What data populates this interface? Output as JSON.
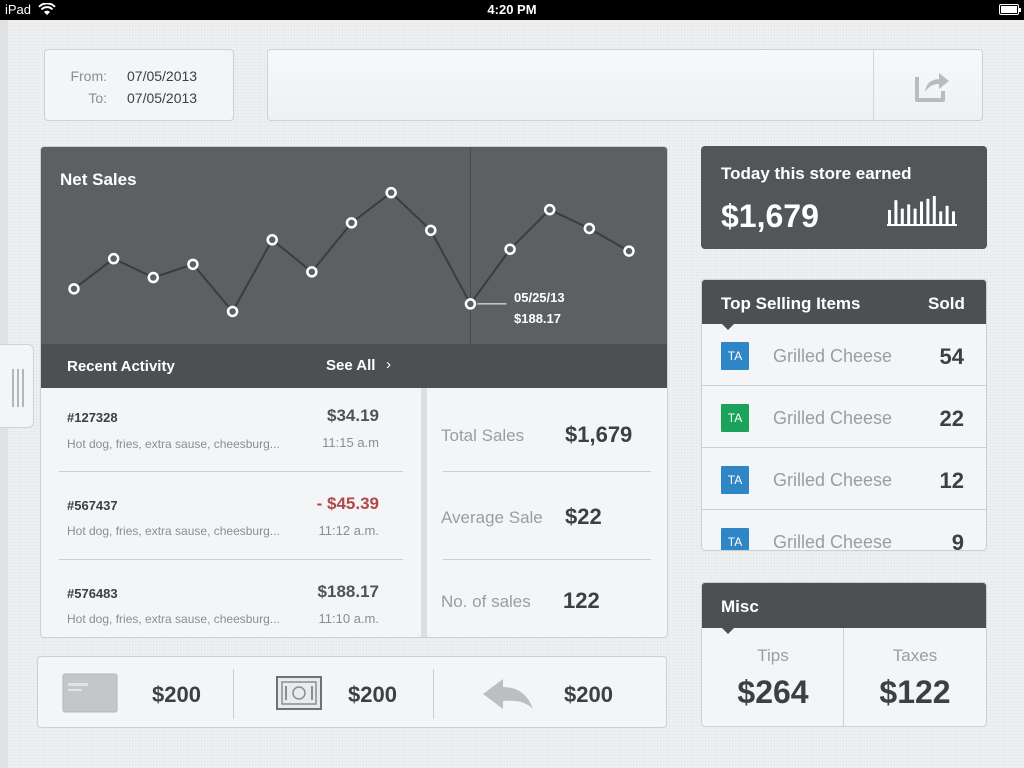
{
  "status_bar": {
    "device": "iPad",
    "time": "4:20 PM"
  },
  "date_range": {
    "from_label": "From:",
    "from_value": "07/05/2013",
    "to_label": "To:",
    "to_value": "07/05/2013"
  },
  "search": {
    "value": "",
    "placeholder": ""
  },
  "share": {
    "icon": "share-icon"
  },
  "net_sales": {
    "title": "Net Sales",
    "callout": {
      "date": "05/25/13",
      "value": "$188.17"
    },
    "chart_data": {
      "type": "line",
      "title": "Net Sales",
      "values": [
        56,
        72,
        62,
        69,
        44,
        82,
        65,
        91,
        107,
        87,
        48,
        77,
        98,
        88,
        76
      ],
      "highlight_index": 10,
      "highlight": {
        "date": "05/25/13",
        "value": "$188.17"
      }
    }
  },
  "recent_activity": {
    "title": "Recent Activity",
    "see_all": "See All",
    "items": [
      {
        "order": "#127328",
        "amount": "$34.19",
        "desc": "Hot dog, fries, extra sause, cheesburg...",
        "time": "11:15 a.m",
        "negative": false
      },
      {
        "order": "#567437",
        "amount": "- $45.39",
        "desc": "Hot dog, fries, extra sause, cheesburg...",
        "time": "11:12 a.m.",
        "negative": true
      },
      {
        "order": "#576483",
        "amount": "$188.17",
        "desc": "Hot dog, fries, extra sause, cheesburg...",
        "time": "11:10 a.m.",
        "negative": false
      }
    ]
  },
  "summary": [
    {
      "label": "Total Sales",
      "value": "$1,679"
    },
    {
      "label": "Average Sale",
      "value": "$22"
    },
    {
      "label": "No. of sales",
      "value": "122"
    }
  ],
  "earnings": {
    "title": "Today this store earned",
    "amount": "$1,679",
    "bars": [
      0.5,
      0.85,
      0.55,
      0.7,
      0.55,
      0.8,
      0.9,
      1.0,
      0.45,
      0.65,
      0.45
    ]
  },
  "top_selling": {
    "title": "Top Selling Items",
    "sold_label": "Sold",
    "items": [
      {
        "badge": "TA",
        "badge_color": "#2f86c6",
        "name": "Grilled Cheese",
        "sold": "54"
      },
      {
        "badge": "TA",
        "badge_color": "#1aa35a",
        "name": "Grilled Cheese",
        "sold": "22"
      },
      {
        "badge": "TA",
        "badge_color": "#2f86c6",
        "name": "Grilled Cheese",
        "sold": "12"
      },
      {
        "badge": "TA",
        "badge_color": "#2f86c6",
        "name": "Grilled Cheese",
        "sold": "9"
      }
    ]
  },
  "misc": {
    "title": "Misc",
    "tips_label": "Tips",
    "tips_value": "$264",
    "taxes_label": "Taxes",
    "taxes_value": "$122"
  },
  "payments": [
    {
      "icon": "credit-card-icon",
      "amount": "$200"
    },
    {
      "icon": "cash-icon",
      "amount": "$200"
    },
    {
      "icon": "refund-icon",
      "amount": "$200"
    }
  ],
  "colors": {
    "dark_panel": "#5d6063",
    "header_panel": "#4d5053",
    "negative": "#b04848",
    "badge_blue": "#2f86c6",
    "badge_green": "#1aa35a"
  }
}
